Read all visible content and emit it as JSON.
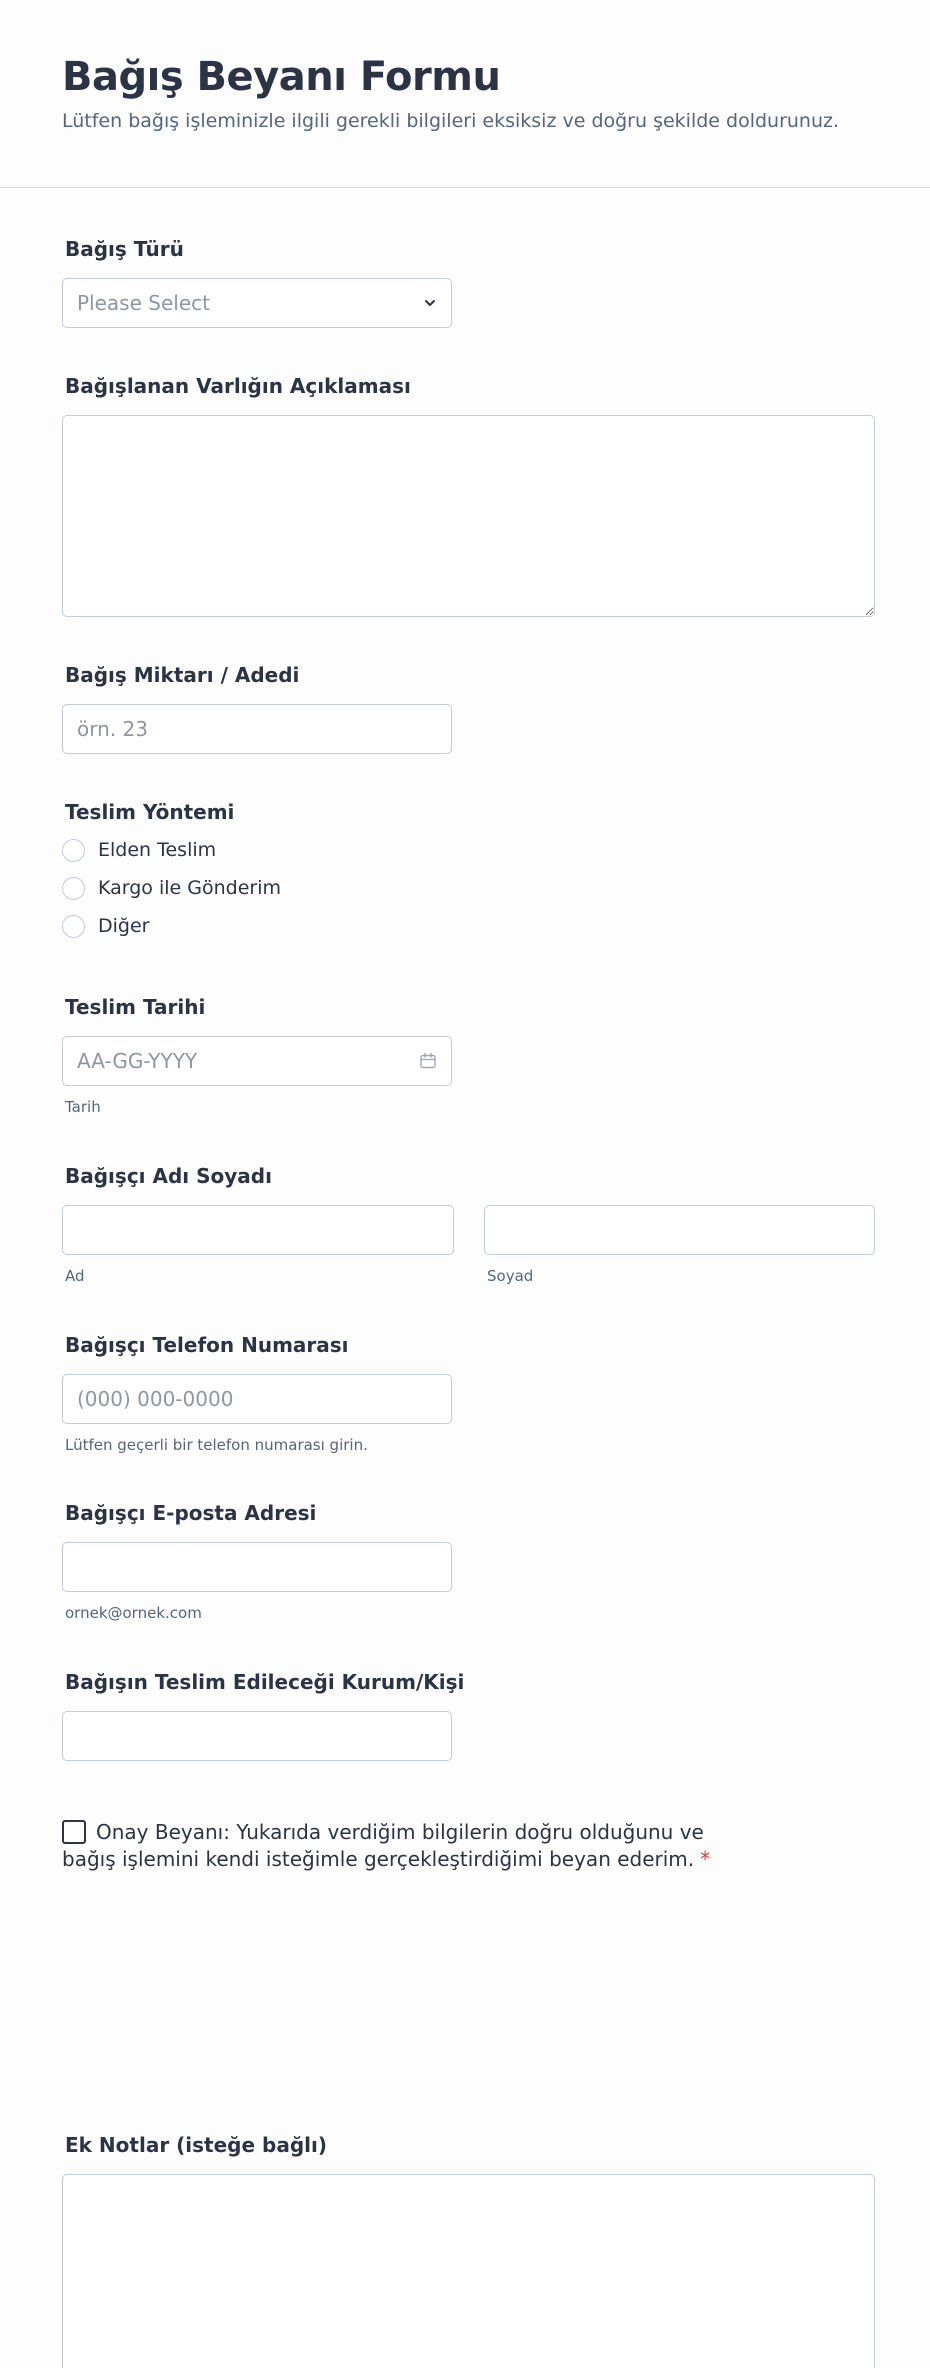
{
  "header": {
    "title": "Bağış Beyanı Formu",
    "subtitle": "Lütfen bağış işleminizle ilgili gerekli bilgileri eksiksiz ve doğru şekilde doldurunuz."
  },
  "donation_type": {
    "label": "Bağış Türü",
    "placeholder": "Please Select"
  },
  "asset_description": {
    "label": "Bağışlanan Varlığın Açıklaması",
    "value": ""
  },
  "amount": {
    "label": "Bağış Miktarı / Adedi",
    "placeholder": "örn. 23"
  },
  "delivery_method": {
    "label": "Teslim Yöntemi",
    "options": [
      "Elden Teslim",
      "Kargo ile Gönderim",
      "Diğer"
    ]
  },
  "delivery_date": {
    "label": "Teslim Tarihi",
    "placeholder": "AA-GG-YYYY",
    "sublabel": "Tarih"
  },
  "donor_name": {
    "label": "Bağışçı Adı Soyadı",
    "first_sublabel": "Ad",
    "last_sublabel": "Soyad"
  },
  "donor_phone": {
    "label": "Bağışçı Telefon Numarası",
    "placeholder": "(000) 000-0000",
    "sublabel": "Lütfen geçerli bir telefon numarası girin."
  },
  "donor_email": {
    "label": "Bağışçı E-posta Adresi",
    "sublabel": "ornek@ornek.com"
  },
  "recipient": {
    "label": "Bağışın Teslim Edileceği Kurum/Kişi"
  },
  "consent": {
    "text": "Onay Beyanı: Yukarıda verdiğim bilgilerin doğru olduğunu ve bağış işlemini kendi isteğimle gerçekleştirdiğimi beyan ederim.",
    "required_mark": "*"
  },
  "notes": {
    "label": "Ek Notlar (isteğe bağlı)"
  },
  "colors": {
    "text": "#2c3345",
    "muted": "#57647e",
    "border": "#c3cad8",
    "required": "#e5323e"
  }
}
